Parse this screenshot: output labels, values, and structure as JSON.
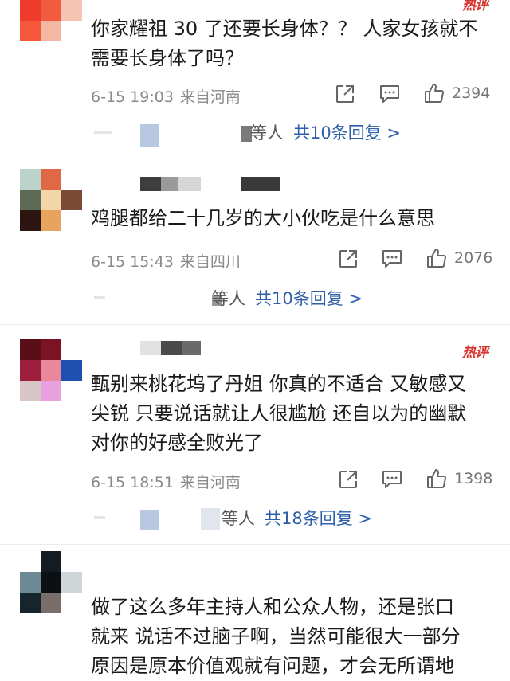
{
  "comments": [
    {
      "text_lines": [
        "你家耀祖 30 了还要长身体？？ 人家女孩就不",
        "需要长身体了吗？"
      ],
      "time": "6-15 19:03",
      "location": "来自河南",
      "likes": "2394",
      "reply_prefix": "等人",
      "reply_link": "共10条回复 >",
      "badge": "热评"
    },
    {
      "text_lines": [
        "鸡腿都给二十几岁的大小伙吃是什么意思"
      ],
      "time": "6-15 15:43",
      "location": "来自四川",
      "likes": "2076",
      "reply_prefix": "等人",
      "reply_link": "共10条回复 >"
    },
    {
      "text_lines": [
        "甄别来桃花坞了丹姐 你真的不适合 又敏感又",
        "尖锐 只要说话就让人很尴尬 还自以为的幽默",
        "对你的好感全败光了"
      ],
      "time": "6-15 18:51",
      "location": "来自河南",
      "likes": "1398",
      "reply_prefix": "等人",
      "reply_link": "共18条回复 >",
      "badge": "热评"
    },
    {
      "text_lines": [
        "做了这么多年主持人和公众人物，还是张口",
        "就来 说话不过脑子啊，当然可能很大一部分",
        "原因是原本价值观就有问题，才会无所谓地"
      ]
    }
  ],
  "icons": {
    "share": "share-icon",
    "comment": "comment-icon",
    "like": "thumbs-up-icon"
  },
  "colors": {
    "reply_link": "#2e5fa8",
    "badge": "#d8332f",
    "meta": "#8a8a8a"
  }
}
